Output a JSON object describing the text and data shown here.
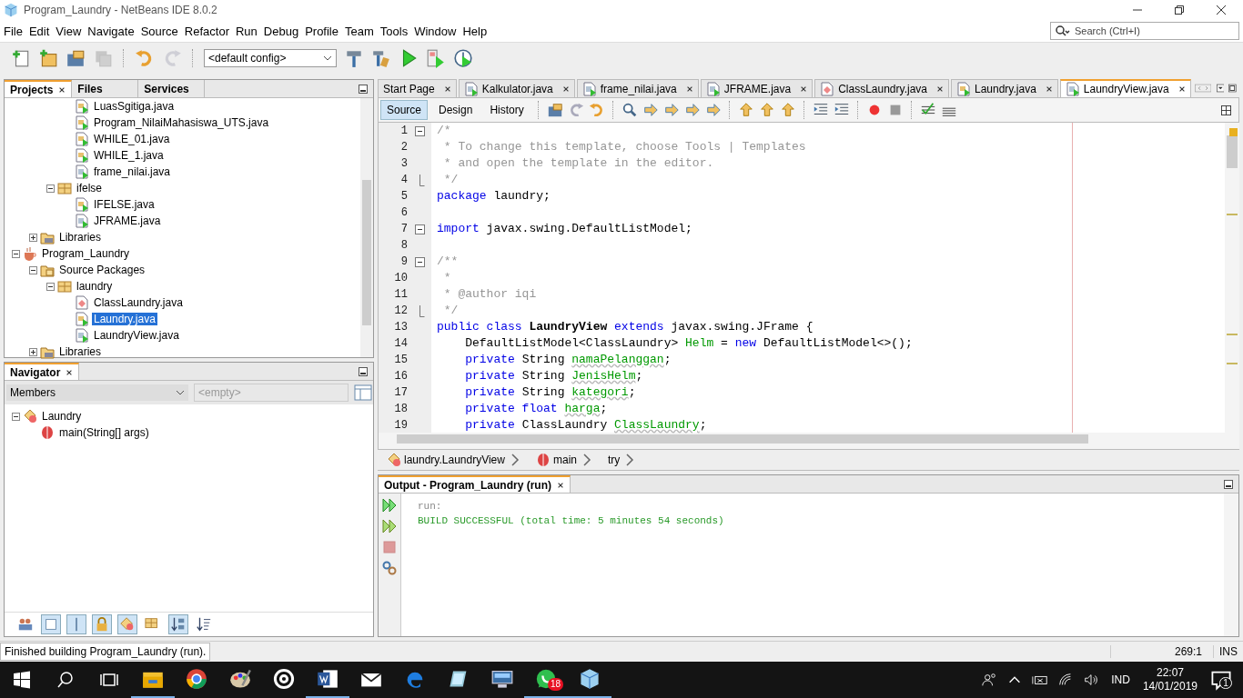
{
  "window": {
    "title": "Program_Laundry - NetBeans IDE 8.0.2"
  },
  "menu": [
    "File",
    "Edit",
    "View",
    "Navigate",
    "Source",
    "Refactor",
    "Run",
    "Debug",
    "Profile",
    "Team",
    "Tools",
    "Window",
    "Help"
  ],
  "search": {
    "placeholder": "Search (Ctrl+I)"
  },
  "toolbar": [
    {
      "kind": "new-file",
      "disabled": false
    },
    {
      "kind": "new-project",
      "disabled": false
    },
    {
      "kind": "open-project",
      "disabled": false
    },
    {
      "kind": "save-all",
      "disabled": true
    },
    {
      "kind": "sep"
    },
    {
      "kind": "undo",
      "disabled": false
    },
    {
      "kind": "redo",
      "disabled": true
    },
    {
      "kind": "sep"
    },
    {
      "kind": "config"
    },
    {
      "kind": "build",
      "disabled": false
    },
    {
      "kind": "clean-build",
      "disabled": false
    },
    {
      "kind": "run",
      "disabled": false
    },
    {
      "kind": "debug",
      "disabled": false
    },
    {
      "kind": "profile",
      "disabled": false
    }
  ],
  "config": {
    "value": "<default config>"
  },
  "projects_panel": {
    "tabs": [
      {
        "label": "Projects",
        "selected": true
      },
      {
        "label": "Files",
        "selected": false
      },
      {
        "label": "Services",
        "selected": false
      }
    ],
    "tree": [
      {
        "children": [
          {
            "children": [
              {
                "children": [
                  {
                    "label": "LuasSgitiga.java",
                    "kind": "java-main",
                    "selected": false
                  },
                  {
                    "label": "Program_NilaiMahasiswa_UTS.java",
                    "kind": "java-main",
                    "selected": false
                  },
                  {
                    "label": "WHILE_01.java",
                    "kind": "java-main",
                    "selected": false
                  },
                  {
                    "label": "WHILE_1.java",
                    "kind": "java-main",
                    "selected": false
                  },
                  {
                    "label": "frame_nilai.java",
                    "kind": "java-form",
                    "selected": false
                  }
                ]
              },
              {
                "label": "ifelse",
                "kind": "package",
                "selected": false,
                "expanded": true,
                "children": [
                  {
                    "label": "IFELSE.java",
                    "kind": "java-main",
                    "selected": false
                  },
                  {
                    "label": "JFRAME.java",
                    "kind": "java-form",
                    "selected": false
                  }
                ]
              }
            ]
          },
          {
            "label": "Libraries",
            "kind": "libraries",
            "selected": false,
            "expanded": false
          }
        ]
      },
      {
        "label": "Program_Laundry",
        "kind": "project",
        "selected": false,
        "expanded": true,
        "children": [
          {
            "label": "Source Packages",
            "kind": "source-folder",
            "selected": false,
            "expanded": true,
            "children": [
              {
                "label": "laundry",
                "kind": "package",
                "selected": false,
                "expanded": true,
                "children": [
                  {
                    "label": "ClassLaundry.java",
                    "kind": "java-class",
                    "selected": false
                  },
                  {
                    "label": "Laundry.java",
                    "kind": "java-main",
                    "selected": true
                  },
                  {
                    "label": "LaundryView.java",
                    "kind": "java-form",
                    "selected": false
                  }
                ]
              }
            ]
          },
          {
            "label": "Libraries",
            "kind": "libraries",
            "selected": false,
            "expanded": false
          }
        ]
      }
    ]
  },
  "navigator": {
    "title": "Navigator",
    "filter": "Members",
    "second_filter": {
      "placeholder": "<empty>",
      "disabled": true
    },
    "tree": [
      {
        "label": "Laundry",
        "kind": "class",
        "expanded": true,
        "children": [
          {
            "label": "main(String[] args)",
            "kind": "method"
          }
        ]
      }
    ],
    "buttons": [
      {
        "kind": "people",
        "selected": false
      },
      {
        "kind": "square",
        "selected": true
      },
      {
        "kind": "bar",
        "selected": true
      },
      {
        "kind": "lock",
        "selected": true
      },
      {
        "kind": "diamond",
        "selected": true
      },
      {
        "kind": "package",
        "selected": false
      },
      {
        "kind": "sort-az",
        "selected": true
      },
      {
        "kind": "sort-list",
        "selected": false
      }
    ]
  },
  "editor_tabs": [
    {
      "label": "Start Page",
      "kind": "none",
      "selected": false
    },
    {
      "label": "Kalkulator.java",
      "kind": "java-form",
      "selected": false
    },
    {
      "label": "frame_nilai.java",
      "kind": "java-form",
      "selected": false
    },
    {
      "label": "JFRAME.java",
      "kind": "java-form",
      "selected": false
    },
    {
      "label": "ClassLaundry.java",
      "kind": "java-class",
      "selected": false
    },
    {
      "label": "Laundry.java",
      "kind": "java-main",
      "selected": false
    },
    {
      "label": "LaundryView.java",
      "kind": "java-form",
      "selected": true
    }
  ],
  "view_tabs": [
    {
      "label": "Source",
      "selected": true
    },
    {
      "label": "Design",
      "selected": false
    },
    {
      "label": "History",
      "selected": false
    }
  ],
  "code": [
    {
      "number": "1",
      "kind": "fold-start",
      "tokens": [
        {
          "kind": "comment",
          "text": "/*"
        }
      ]
    },
    {
      "number": "2",
      "kind": "plain",
      "tokens": [
        {
          "kind": "comment",
          "text": " * To change this template, choose Tools | Templates"
        }
      ]
    },
    {
      "number": "3",
      "kind": "plain",
      "tokens": [
        {
          "kind": "comment",
          "text": " * and open the template in the editor."
        }
      ]
    },
    {
      "number": "4",
      "kind": "fold-end",
      "tokens": [
        {
          "kind": "comment",
          "text": " */"
        }
      ]
    },
    {
      "number": "5",
      "kind": "plain",
      "tokens": [
        {
          "kind": "keyword",
          "text": "package"
        },
        {
          "kind": "plain",
          "text": " laundry;"
        }
      ]
    },
    {
      "number": "6",
      "kind": "plain"
    },
    {
      "number": "7",
      "kind": "fold-start",
      "tokens": [
        {
          "kind": "keyword",
          "text": "import"
        },
        {
          "kind": "plain",
          "text": " javax.swing.DefaultListModel;"
        }
      ]
    },
    {
      "number": "8",
      "kind": "plain"
    },
    {
      "number": "9",
      "kind": "fold-start",
      "tokens": [
        {
          "kind": "comment",
          "text": "/**"
        }
      ]
    },
    {
      "number": "10",
      "kind": "plain",
      "tokens": [
        {
          "kind": "comment",
          "text": " *"
        }
      ]
    },
    {
      "number": "11",
      "kind": "plain",
      "tokens": [
        {
          "kind": "comment",
          "text": " * @author iqi"
        }
      ]
    },
    {
      "number": "12",
      "kind": "fold-end",
      "tokens": [
        {
          "kind": "comment",
          "text": " */"
        }
      ]
    },
    {
      "number": "13",
      "kind": "plain",
      "tokens": [
        {
          "kind": "keyword",
          "text": "public class "
        },
        {
          "kind": "name",
          "text": "LaundryView"
        },
        {
          "kind": "keyword",
          "text": " extends"
        },
        {
          "kind": "plain",
          "text": " javax.swing.JFrame {"
        }
      ]
    },
    {
      "number": "14",
      "kind": "plain",
      "tokens": [
        {
          "kind": "plain",
          "text": "    DefaultListModel<ClassLaundry> "
        },
        {
          "kind": "field",
          "text": "Helm"
        },
        {
          "kind": "plain",
          "text": " = "
        },
        {
          "kind": "keyword",
          "text": "new"
        },
        {
          "kind": "plain",
          "text": " DefaultListModel<>();"
        }
      ]
    },
    {
      "number": "15",
      "kind": "plain",
      "tokens": [
        {
          "kind": "keyword",
          "text": "    private"
        },
        {
          "kind": "plain",
          "text": " String "
        },
        {
          "kind": "field-warning",
          "text": "namaPelanggan"
        },
        {
          "kind": "plain",
          "text": ";"
        }
      ]
    },
    {
      "number": "16",
      "kind": "plain",
      "tokens": [
        {
          "kind": "keyword",
          "text": "    private"
        },
        {
          "kind": "plain",
          "text": " String "
        },
        {
          "kind": "field-warning",
          "text": "JenisHelm"
        },
        {
          "kind": "plain",
          "text": ";"
        }
      ]
    },
    {
      "number": "17",
      "kind": "plain",
      "tokens": [
        {
          "kind": "keyword",
          "text": "    private"
        },
        {
          "kind": "plain",
          "text": " String "
        },
        {
          "kind": "field-warning",
          "text": "kategori"
        },
        {
          "kind": "plain",
          "text": ";"
        }
      ]
    },
    {
      "number": "18",
      "kind": "plain",
      "tokens": [
        {
          "kind": "keyword",
          "text": "    private float "
        },
        {
          "kind": "field-warning",
          "text": "harga"
        },
        {
          "kind": "plain",
          "text": ";"
        }
      ]
    },
    {
      "number": "19",
      "kind": "plain",
      "tokens": [
        {
          "kind": "keyword",
          "text": "    private"
        },
        {
          "kind": "plain",
          "text": " ClassLaundry "
        },
        {
          "kind": "field-warning",
          "text": "ClassLaundry"
        },
        {
          "kind": "plain",
          "text": ";"
        }
      ]
    }
  ],
  "breadcrumbs": [
    {
      "label": "laundry.LaundryView",
      "kind": "class"
    },
    {
      "label": "main",
      "kind": "method"
    },
    {
      "label": "try",
      "kind": "none"
    }
  ],
  "output": {
    "title": "Output - Program_Laundry (run)",
    "lines": [
      {
        "kind": "info",
        "text": "run:"
      },
      {
        "kind": "success",
        "text": "BUILD SUCCESSFUL (total time: 5 minutes 54 seconds)"
      }
    ]
  },
  "status_bar": {
    "message": "Finished building Program_Laundry (run).",
    "position": "269:1",
    "mode": "INS"
  },
  "taskbar": {
    "apps": [
      {
        "kind": "explorer",
        "active": true
      },
      {
        "kind": "chrome",
        "active": false
      },
      {
        "kind": "paint",
        "active": false
      },
      {
        "kind": "groove",
        "active": false
      },
      {
        "kind": "word",
        "active": true
      },
      {
        "kind": "mail",
        "active": false
      },
      {
        "kind": "edge",
        "active": false
      },
      {
        "kind": "tool",
        "active": false
      },
      {
        "kind": "remote",
        "active": false
      },
      {
        "kind": "whatsapp",
        "active": true,
        "badge": "18"
      },
      {
        "kind": "cube",
        "active": true
      }
    ],
    "language": "IND",
    "time": "22:07",
    "date": "14/01/2019",
    "notifications": "1"
  }
}
